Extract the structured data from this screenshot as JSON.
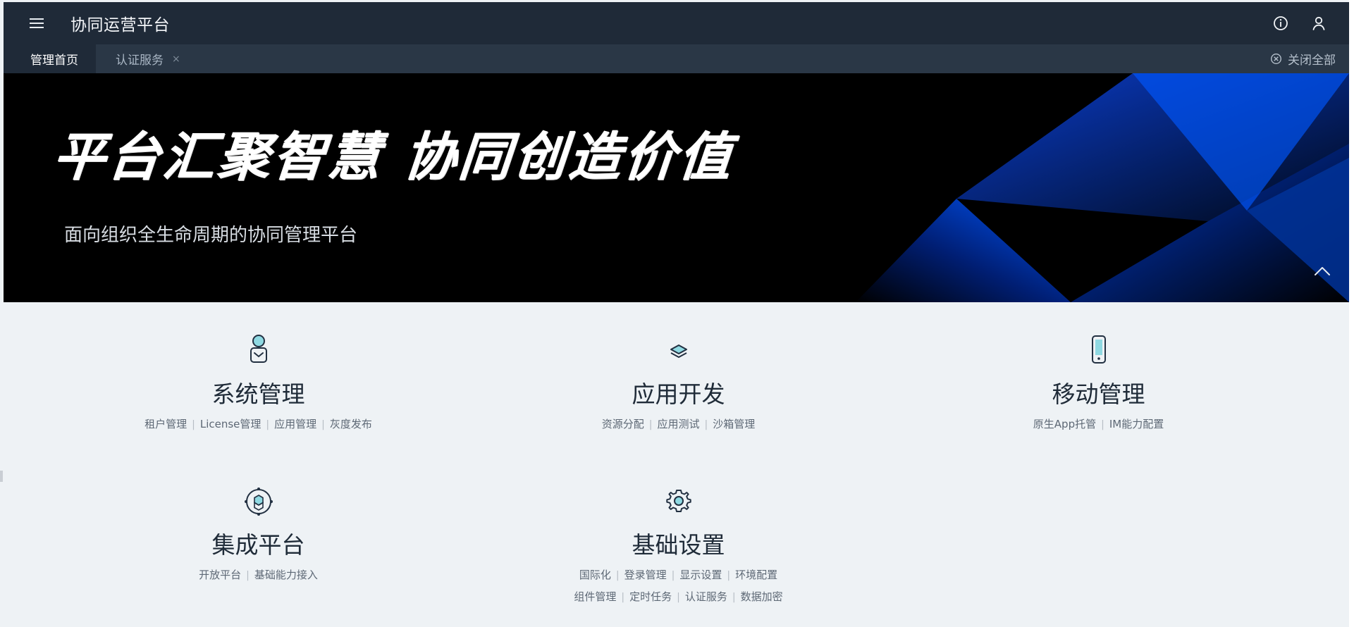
{
  "header": {
    "title": "协同运营平台",
    "menu_icon": "hamburger-icon",
    "right_icons": [
      "info-icon",
      "user-icon"
    ]
  },
  "tabs": {
    "items": [
      {
        "label": "管理首页",
        "active": true
      },
      {
        "label": "认证服务",
        "active": false,
        "close": "×"
      }
    ],
    "close_all": "关闭全部"
  },
  "banner": {
    "headline": "平台汇聚智慧  协同创造价值",
    "subline": "面向组织全生命周期的协同管理平台",
    "accent_colors": [
      "#0033cc",
      "#0a63ff",
      "#000000"
    ]
  },
  "modules": [
    {
      "title": "系统管理",
      "icon": "user-icon",
      "links": [
        "租户管理",
        "License管理",
        "应用管理",
        "灰度发布"
      ]
    },
    {
      "title": "应用开发",
      "icon": "layers-icon",
      "links": [
        "资源分配",
        "应用测试",
        "沙箱管理"
      ]
    },
    {
      "title": "移动管理",
      "icon": "mobile-icon",
      "links": [
        "原生App托管",
        "IM能力配置"
      ]
    },
    {
      "title": "集成平台",
      "icon": "integration-icon",
      "links": [
        "开放平台",
        "基础能力接入"
      ]
    },
    {
      "title": "基础设置",
      "icon": "gear-icon",
      "links": [
        "国际化",
        "登录管理",
        "显示设置",
        "环境配置",
        "组件管理",
        "定时任务",
        "认证服务",
        "数据加密"
      ]
    }
  ]
}
